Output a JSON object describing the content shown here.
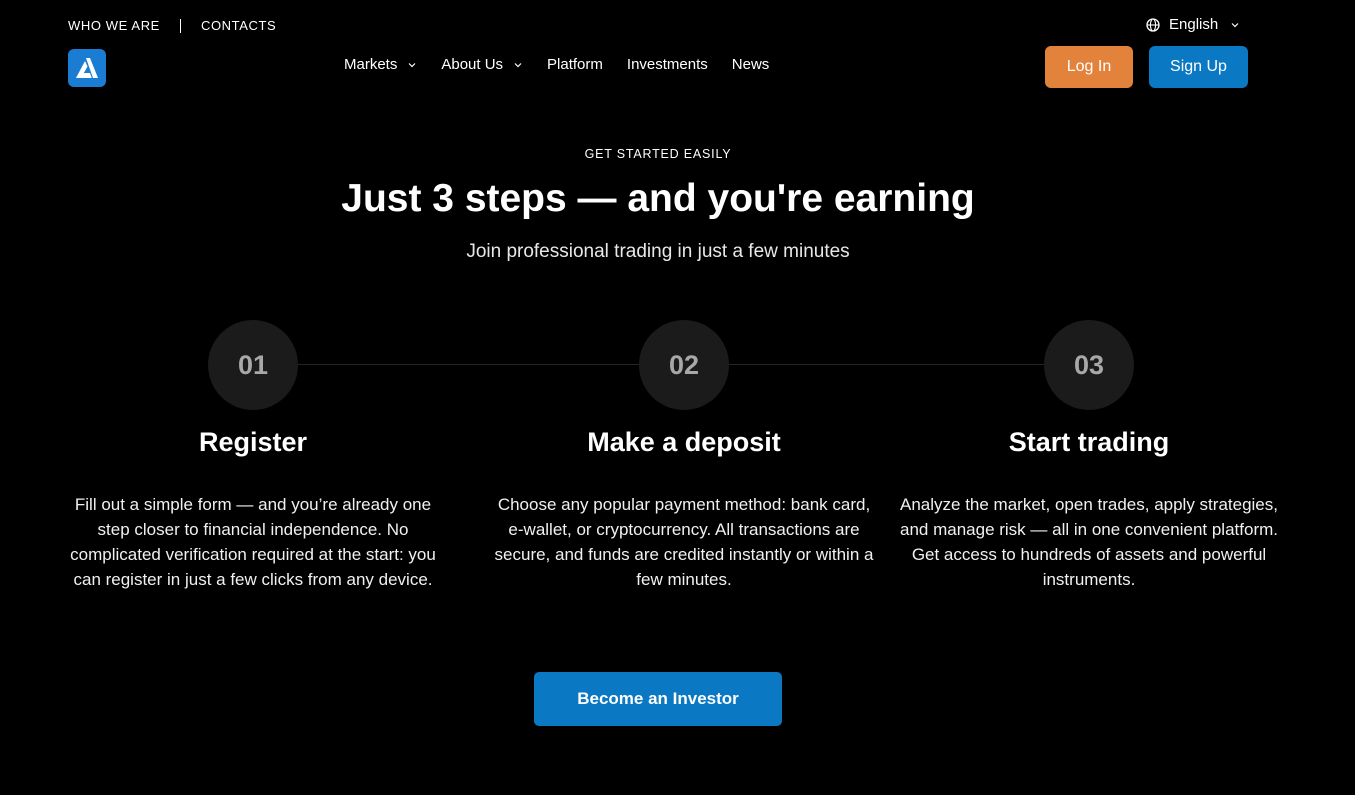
{
  "top_links": {
    "who_we_are": "WHO WE ARE",
    "contacts": "CONTACTS"
  },
  "language": {
    "selected": "English"
  },
  "nav": {
    "markets": "Markets",
    "about_us": "About Us",
    "platform": "Platform",
    "investments": "Investments",
    "news": "News"
  },
  "auth": {
    "login": "Log In",
    "signup": "Sign Up"
  },
  "hero": {
    "eyebrow": "GET STARTED EASILY",
    "title": "Just 3 steps — and you're earning",
    "subtitle": "Join professional trading in just a few minutes"
  },
  "steps": [
    {
      "number": "01",
      "title": "Register",
      "description": "Fill out a simple form — and you’re already one step closer to financial independence. No complicated verification required at the start: you can register in just a few clicks from any device."
    },
    {
      "number": "02",
      "title": "Make a deposit",
      "description": "Choose any popular payment method: bank card, e-wallet, or cryptocurrency. All transactions are secure, and funds are credited instantly or within a few minutes."
    },
    {
      "number": "03",
      "title": "Start trading",
      "description": "Analyze the market, open trades, apply strategies, and manage risk — all in one convenient platform. Get access to hundreds of assets and powerful instruments."
    }
  ],
  "cta": {
    "label": "Become an Investor"
  },
  "colors": {
    "background": "#000000",
    "brand_blue": "#0a78c2",
    "login_orange": "#e3823b",
    "step_circle": "#1b1b1b"
  },
  "icons": {
    "logo": "brand-logo-icon",
    "globe": "globe-icon",
    "chevron": "chevron-down-icon"
  }
}
